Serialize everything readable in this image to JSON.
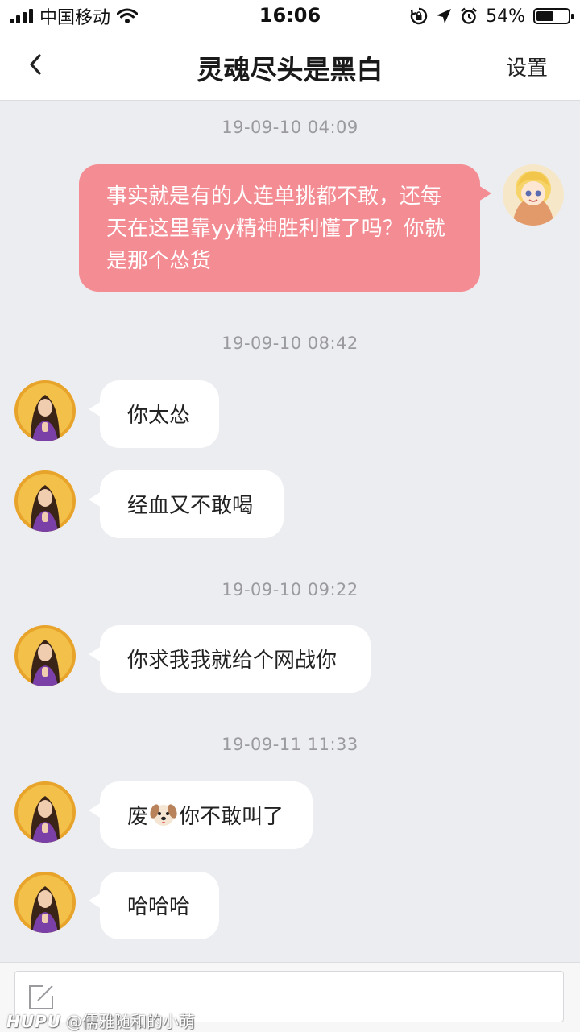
{
  "status_bar": {
    "carrier": "中国移动",
    "time": "16:06",
    "battery_text": "54%",
    "battery_level": 0.54,
    "icons": [
      "signal-icon",
      "wifi-icon",
      "rotation-lock-icon",
      "location-icon",
      "alarm-icon",
      "battery-icon"
    ]
  },
  "nav": {
    "title": "灵魂尽头是黑白",
    "back_icon": "chevron-left-icon",
    "settings_label": "设置"
  },
  "messages": [
    {
      "type": "timestamp",
      "text": "19-09-10 04:09"
    },
    {
      "type": "outgoing",
      "text": "事实就是有的人连单挑都不敢，还每天在这里靠yy精神胜利懂了吗？你就是那个怂货"
    },
    {
      "type": "timestamp",
      "text": "19-09-10 08:42"
    },
    {
      "type": "incoming",
      "text": "你太怂"
    },
    {
      "type": "incoming",
      "text": "经血又不敢喝"
    },
    {
      "type": "timestamp",
      "text": "19-09-10 09:22"
    },
    {
      "type": "incoming",
      "text": "你求我我就给个网战你"
    },
    {
      "type": "timestamp",
      "text": "19-09-11 11:33"
    },
    {
      "type": "incoming",
      "text_before": "废",
      "emoji": "dog-face-icon",
      "text_after": "你不敢叫了"
    },
    {
      "type": "incoming",
      "text": "哈哈哈"
    }
  ],
  "input": {
    "compose_icon": "compose-icon"
  },
  "watermark": {
    "brand": "HUPU",
    "text": "@儒雅随和的小萌"
  },
  "colors": {
    "outgoing_bubble": "#f48c93",
    "incoming_bubble": "#ffffff",
    "background": "#ecedf0",
    "timestamp_text": "#9a9a9f"
  }
}
